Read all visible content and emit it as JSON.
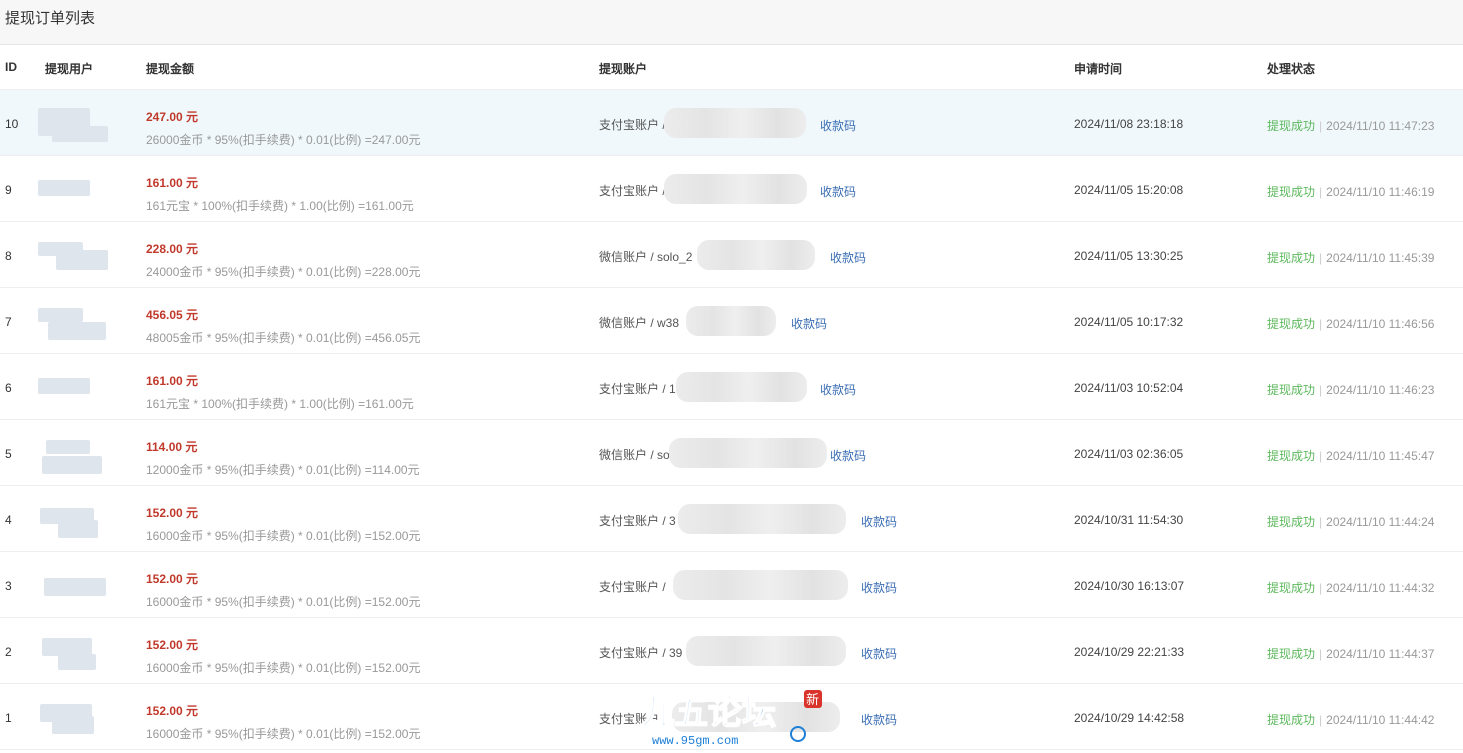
{
  "title": "提现订单列表",
  "columns": {
    "id": "ID",
    "user": "提现用户",
    "amount": "提现金额",
    "account": "提现账户",
    "time": "申请时间",
    "status": "处理状态"
  },
  "qr_label": "收款码",
  "rows": [
    {
      "id": "10",
      "amount": "247.00 元",
      "formula": "26000金币 * 95%(扣手续费) * 0.01(比例) =247.00元",
      "account": "支付宝账户 / ",
      "time": "2024/11/08 23:18:18",
      "status": "提现成功",
      "done": "2024/11/10 11:47:23"
    },
    {
      "id": "9",
      "amount": "161.00 元",
      "formula": "161元宝 * 100%(扣手续费) * 1.00(比例) =161.00元",
      "account": "支付宝账户 / ",
      "time": "2024/11/05 15:20:08",
      "status": "提现成功",
      "done": "2024/11/10 11:46:19"
    },
    {
      "id": "8",
      "amount": "228.00 元",
      "formula": "24000金币 * 95%(扣手续费) * 0.01(比例) =228.00元",
      "account": "微信账户 / solo_2",
      "time": "2024/11/05 13:30:25",
      "status": "提现成功",
      "done": "2024/11/10 11:45:39"
    },
    {
      "id": "7",
      "amount": "456.05 元",
      "formula": "48005金币 * 95%(扣手续费) * 0.01(比例) =456.05元",
      "account": "微信账户 / w38",
      "time": "2024/11/05 10:17:32",
      "status": "提现成功",
      "done": "2024/11/10 11:46:56"
    },
    {
      "id": "6",
      "amount": "161.00 元",
      "formula": "161元宝 * 100%(扣手续费) * 1.00(比例) =161.00元",
      "account": "支付宝账户 / 1",
      "time": "2024/11/03 10:52:04",
      "status": "提现成功",
      "done": "2024/11/10 11:46:23"
    },
    {
      "id": "5",
      "amount": "114.00 元",
      "formula": "12000金币 * 95%(扣手续费) * 0.01(比例) =114.00元",
      "account": "微信账户 / so",
      "time": "2024/11/03 02:36:05",
      "status": "提现成功",
      "done": "2024/11/10 11:45:47"
    },
    {
      "id": "4",
      "amount": "152.00 元",
      "formula": "16000金币 * 95%(扣手续费) * 0.01(比例) =152.00元",
      "account": "支付宝账户 / 3",
      "time": "2024/10/31 11:54:30",
      "status": "提现成功",
      "done": "2024/11/10 11:44:24"
    },
    {
      "id": "3",
      "amount": "152.00 元",
      "formula": "16000金币 * 95%(扣手续费) * 0.01(比例) =152.00元",
      "account": "支付宝账户 / ",
      "time": "2024/10/30 16:13:07",
      "status": "提现成功",
      "done": "2024/11/10 11:44:32"
    },
    {
      "id": "2",
      "amount": "152.00 元",
      "formula": "16000金币 * 95%(扣手续费) * 0.01(比例) =152.00元",
      "account": "支付宝账户 / 39",
      "time": "2024/10/29 22:21:33",
      "status": "提现成功",
      "done": "2024/11/10 11:44:37"
    },
    {
      "id": "1",
      "amount": "152.00 元",
      "formula": "16000金币 * 95%(扣手续费) * 0.01(比例) =152.00元",
      "account": "支付宝账户",
      "time": "2024/10/29 14:42:58",
      "status": "提现成功",
      "done": "2024/11/10 11:44:42"
    }
  ],
  "watermark": {
    "title": "九五论坛",
    "url": "www.95gm.com",
    "badge": "新"
  },
  "colors": {
    "amount": "#c0392b",
    "success": "#5cb85c",
    "link": "#3a6db3",
    "highlight_row": "#f0f8fc"
  }
}
